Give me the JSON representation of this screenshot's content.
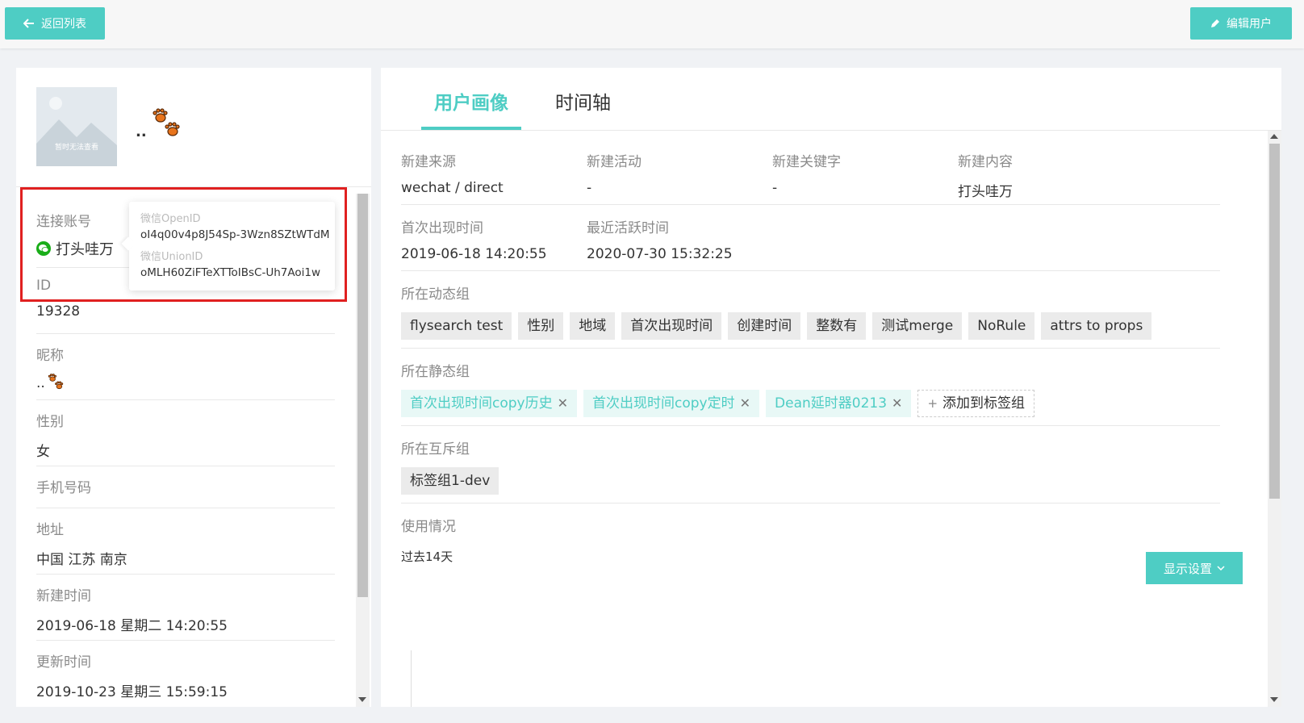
{
  "header": {
    "back_label": "返回列表",
    "edit_label": "编辑用户"
  },
  "profile": {
    "avatar_caption": "暂时无法查看",
    "nickname": ".."
  },
  "fields": [
    {
      "label": "连接账号",
      "value": "打头哇万"
    },
    {
      "label": "ID",
      "value": "19328"
    },
    {
      "label": "昵称",
      "value": ".."
    },
    {
      "label": "性别",
      "value": "女"
    },
    {
      "label": "手机号码",
      "value": ""
    },
    {
      "label": "地址",
      "value": "中国 江苏 南京"
    },
    {
      "label": "新建时间",
      "value": "2019-06-18 星期二 14:20:55"
    },
    {
      "label": "更新时间",
      "value": "2019-10-23 星期三 15:59:15"
    }
  ],
  "tooltip": {
    "openid_label": "微信OpenID",
    "openid_value": "oI4q00v4p8J54Sp-3Wzn8SZtWTdM",
    "unionid_label": "微信UnionID",
    "unionid_value": "oMLH60ZiFTeXTToIBsC-Uh7Aoi1w"
  },
  "tabs": [
    {
      "label": "用户画像",
      "active": true
    },
    {
      "label": "时间轴",
      "active": false
    }
  ],
  "info_row1": [
    {
      "label": "新建来源",
      "value": "wechat / direct"
    },
    {
      "label": "新建活动",
      "value": "-"
    },
    {
      "label": "新建关键字",
      "value": "-"
    },
    {
      "label": "新建内容",
      "value": "打头哇万"
    }
  ],
  "info_row2": [
    {
      "label": "首次出现时间",
      "value": "2019-06-18 14:20:55"
    },
    {
      "label": "最近活跃时间",
      "value": "2020-07-30 15:32:25"
    }
  ],
  "dynamic_groups": {
    "title": "所在动态组",
    "tags": [
      "flysearch test",
      "性别",
      "地域",
      "首次出现时间",
      "创建时间",
      "整数有",
      "测试merge",
      "NoRule",
      "attrs to props"
    ]
  },
  "static_groups": {
    "title": "所在静态组",
    "tags": [
      "首次出现时间copy历史",
      "首次出现时间copy定时",
      "Dean延时器0213"
    ],
    "add_label": "添加到标签组"
  },
  "mutex_groups": {
    "title": "所在互斥组",
    "tags": [
      "标签组1-dev"
    ]
  },
  "usage": {
    "title": "使用情况",
    "period": "过去14天",
    "display_settings_label": "显示设置"
  },
  "colors": {
    "accent": "#4ecdc4",
    "highlight_box": "#e02020",
    "wechat_green": "#1aad19"
  }
}
